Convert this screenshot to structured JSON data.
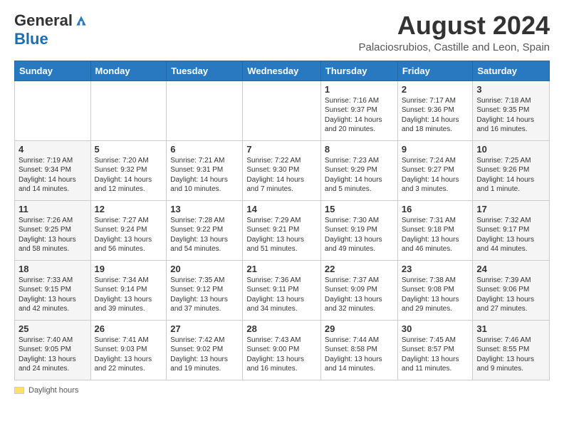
{
  "header": {
    "logo_general": "General",
    "logo_blue": "Blue",
    "main_title": "August 2024",
    "subtitle": "Palaciosrubios, Castille and Leon, Spain"
  },
  "calendar": {
    "days_of_week": [
      "Sunday",
      "Monday",
      "Tuesday",
      "Wednesday",
      "Thursday",
      "Friday",
      "Saturday"
    ],
    "weeks": [
      [
        {
          "day": "",
          "content": ""
        },
        {
          "day": "",
          "content": ""
        },
        {
          "day": "",
          "content": ""
        },
        {
          "day": "",
          "content": ""
        },
        {
          "day": "1",
          "content": "Sunrise: 7:16 AM\nSunset: 9:37 PM\nDaylight: 14 hours and 20 minutes."
        },
        {
          "day": "2",
          "content": "Sunrise: 7:17 AM\nSunset: 9:36 PM\nDaylight: 14 hours and 18 minutes."
        },
        {
          "day": "3",
          "content": "Sunrise: 7:18 AM\nSunset: 9:35 PM\nDaylight: 14 hours and 16 minutes."
        }
      ],
      [
        {
          "day": "4",
          "content": "Sunrise: 7:19 AM\nSunset: 9:34 PM\nDaylight: 14 hours and 14 minutes."
        },
        {
          "day": "5",
          "content": "Sunrise: 7:20 AM\nSunset: 9:32 PM\nDaylight: 14 hours and 12 minutes."
        },
        {
          "day": "6",
          "content": "Sunrise: 7:21 AM\nSunset: 9:31 PM\nDaylight: 14 hours and 10 minutes."
        },
        {
          "day": "7",
          "content": "Sunrise: 7:22 AM\nSunset: 9:30 PM\nDaylight: 14 hours and 7 minutes."
        },
        {
          "day": "8",
          "content": "Sunrise: 7:23 AM\nSunset: 9:29 PM\nDaylight: 14 hours and 5 minutes."
        },
        {
          "day": "9",
          "content": "Sunrise: 7:24 AM\nSunset: 9:27 PM\nDaylight: 14 hours and 3 minutes."
        },
        {
          "day": "10",
          "content": "Sunrise: 7:25 AM\nSunset: 9:26 PM\nDaylight: 14 hours and 1 minute."
        }
      ],
      [
        {
          "day": "11",
          "content": "Sunrise: 7:26 AM\nSunset: 9:25 PM\nDaylight: 13 hours and 58 minutes."
        },
        {
          "day": "12",
          "content": "Sunrise: 7:27 AM\nSunset: 9:24 PM\nDaylight: 13 hours and 56 minutes."
        },
        {
          "day": "13",
          "content": "Sunrise: 7:28 AM\nSunset: 9:22 PM\nDaylight: 13 hours and 54 minutes."
        },
        {
          "day": "14",
          "content": "Sunrise: 7:29 AM\nSunset: 9:21 PM\nDaylight: 13 hours and 51 minutes."
        },
        {
          "day": "15",
          "content": "Sunrise: 7:30 AM\nSunset: 9:19 PM\nDaylight: 13 hours and 49 minutes."
        },
        {
          "day": "16",
          "content": "Sunrise: 7:31 AM\nSunset: 9:18 PM\nDaylight: 13 hours and 46 minutes."
        },
        {
          "day": "17",
          "content": "Sunrise: 7:32 AM\nSunset: 9:17 PM\nDaylight: 13 hours and 44 minutes."
        }
      ],
      [
        {
          "day": "18",
          "content": "Sunrise: 7:33 AM\nSunset: 9:15 PM\nDaylight: 13 hours and 42 minutes."
        },
        {
          "day": "19",
          "content": "Sunrise: 7:34 AM\nSunset: 9:14 PM\nDaylight: 13 hours and 39 minutes."
        },
        {
          "day": "20",
          "content": "Sunrise: 7:35 AM\nSunset: 9:12 PM\nDaylight: 13 hours and 37 minutes."
        },
        {
          "day": "21",
          "content": "Sunrise: 7:36 AM\nSunset: 9:11 PM\nDaylight: 13 hours and 34 minutes."
        },
        {
          "day": "22",
          "content": "Sunrise: 7:37 AM\nSunset: 9:09 PM\nDaylight: 13 hours and 32 minutes."
        },
        {
          "day": "23",
          "content": "Sunrise: 7:38 AM\nSunset: 9:08 PM\nDaylight: 13 hours and 29 minutes."
        },
        {
          "day": "24",
          "content": "Sunrise: 7:39 AM\nSunset: 9:06 PM\nDaylight: 13 hours and 27 minutes."
        }
      ],
      [
        {
          "day": "25",
          "content": "Sunrise: 7:40 AM\nSunset: 9:05 PM\nDaylight: 13 hours and 24 minutes."
        },
        {
          "day": "26",
          "content": "Sunrise: 7:41 AM\nSunset: 9:03 PM\nDaylight: 13 hours and 22 minutes."
        },
        {
          "day": "27",
          "content": "Sunrise: 7:42 AM\nSunset: 9:02 PM\nDaylight: 13 hours and 19 minutes."
        },
        {
          "day": "28",
          "content": "Sunrise: 7:43 AM\nSunset: 9:00 PM\nDaylight: 13 hours and 16 minutes."
        },
        {
          "day": "29",
          "content": "Sunrise: 7:44 AM\nSunset: 8:58 PM\nDaylight: 13 hours and 14 minutes."
        },
        {
          "day": "30",
          "content": "Sunrise: 7:45 AM\nSunset: 8:57 PM\nDaylight: 13 hours and 11 minutes."
        },
        {
          "day": "31",
          "content": "Sunrise: 7:46 AM\nSunset: 8:55 PM\nDaylight: 13 hours and 9 minutes."
        }
      ]
    ]
  },
  "footer": {
    "swatch_label": "Daylight hours"
  }
}
